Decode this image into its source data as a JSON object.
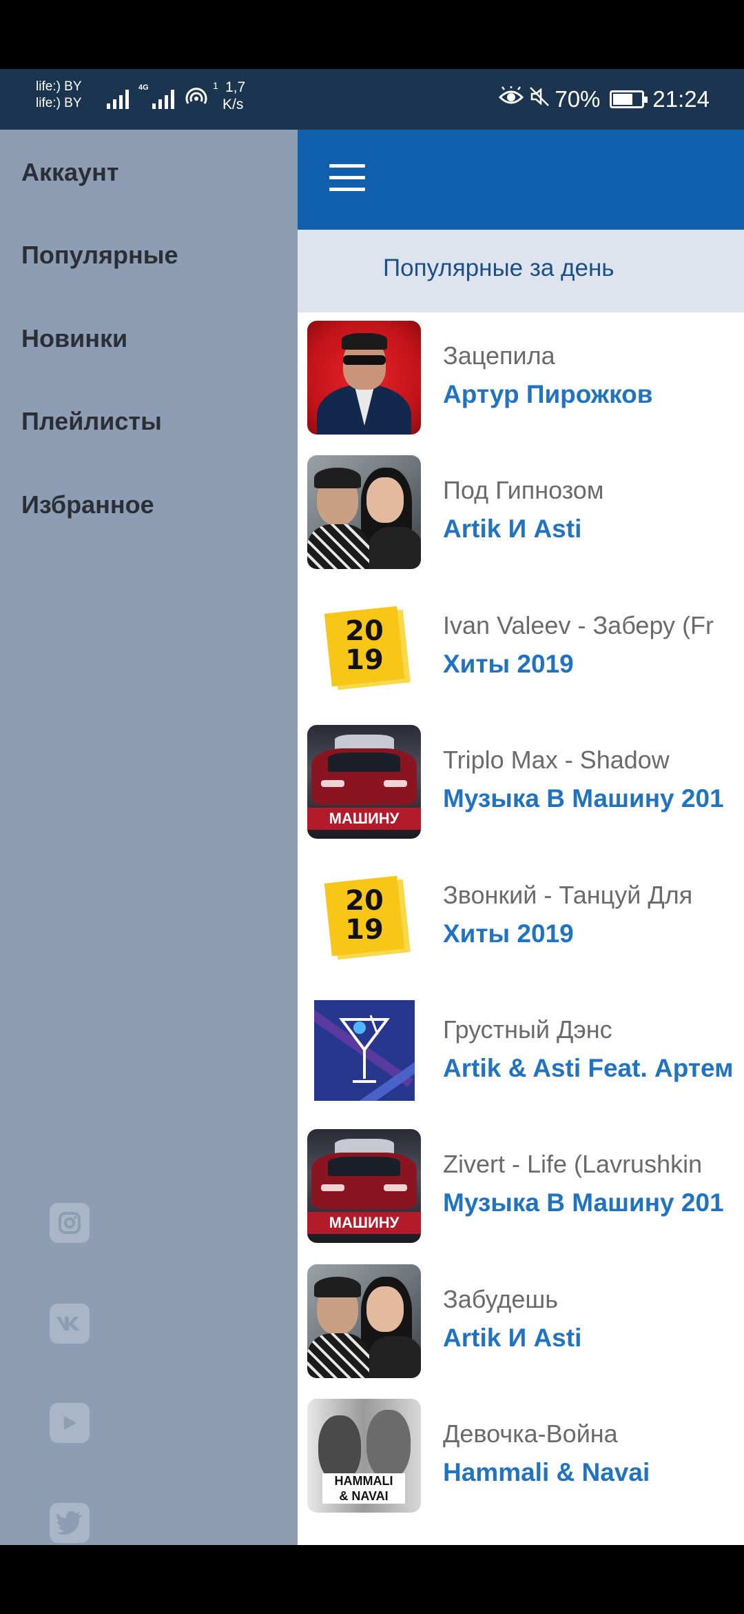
{
  "status_bar": {
    "carrier_1": "life:) BY",
    "carrier_2": "life:) BY",
    "network_type": "4G",
    "speed_sup": "1",
    "speed_value": "1,7",
    "speed_unit": "K/s",
    "battery_percent": "70%",
    "battery_level": 0.7,
    "time": "21:24",
    "icons": [
      "signal-icon",
      "signal-4g-icon",
      "hotspot-icon",
      "eye-comfort-icon",
      "mute-icon",
      "battery-icon"
    ]
  },
  "drawer": {
    "items": [
      {
        "label": "Аккаунт",
        "name": "drawer-item-account"
      },
      {
        "label": "Популярные",
        "name": "drawer-item-popular"
      },
      {
        "label": "Новинки",
        "name": "drawer-item-new"
      },
      {
        "label": "Плейлисты",
        "name": "drawer-item-playlists"
      },
      {
        "label": "Избранное",
        "name": "drawer-item-favorites"
      }
    ],
    "social": [
      "instagram-icon",
      "vk-icon",
      "youtube-icon",
      "twitter-icon"
    ]
  },
  "main": {
    "subheader": "Популярные за день",
    "tracks": [
      {
        "title": "Зацепила",
        "artist": "Артур Пирожков",
        "cover": "artist-photo-red"
      },
      {
        "title": "Под Гипнозом",
        "artist": "Artik И Asti",
        "cover": "duo-photo"
      },
      {
        "title": "Ivan Valeev - Заберу (Fr",
        "artist": "Хиты 2019",
        "cover": "hits-2019",
        "cover_text_top": "20",
        "cover_text_bottom": "19"
      },
      {
        "title": "Triplo Max - Shadow",
        "artist": "Музыка В Машину 201",
        "cover": "car",
        "cover_text": "МАШИНУ"
      },
      {
        "title": "Звонкий - Танцуй Для",
        "artist": "Хиты 2019",
        "cover": "hits-2019",
        "cover_text_top": "20",
        "cover_text_bottom": "19"
      },
      {
        "title": "Грустный Дэнс",
        "artist": "Artik & Asti Feat. Артем",
        "cover": "cocktail"
      },
      {
        "title": "Zivert - Life (Lavrushkin",
        "artist": "Музыка В Машину 201",
        "cover": "car",
        "cover_text": "МАШИНУ"
      },
      {
        "title": "Забудешь",
        "artist": "Artik И Asti",
        "cover": "duo-photo"
      },
      {
        "title": "Девочка-Война",
        "artist": "Hammali & Navai",
        "cover": "hammali-navai",
        "cover_text_top": "HAMMALI",
        "cover_text_bottom": "& NAVAI"
      }
    ]
  },
  "colors": {
    "status_bar": "#1b3550",
    "drawer": "#8c9db4",
    "app_bar": "#0f5fad",
    "subheader_bg": "#dde4ee",
    "artist_text": "#1f73c2",
    "title_text": "#6a6a6a"
  }
}
